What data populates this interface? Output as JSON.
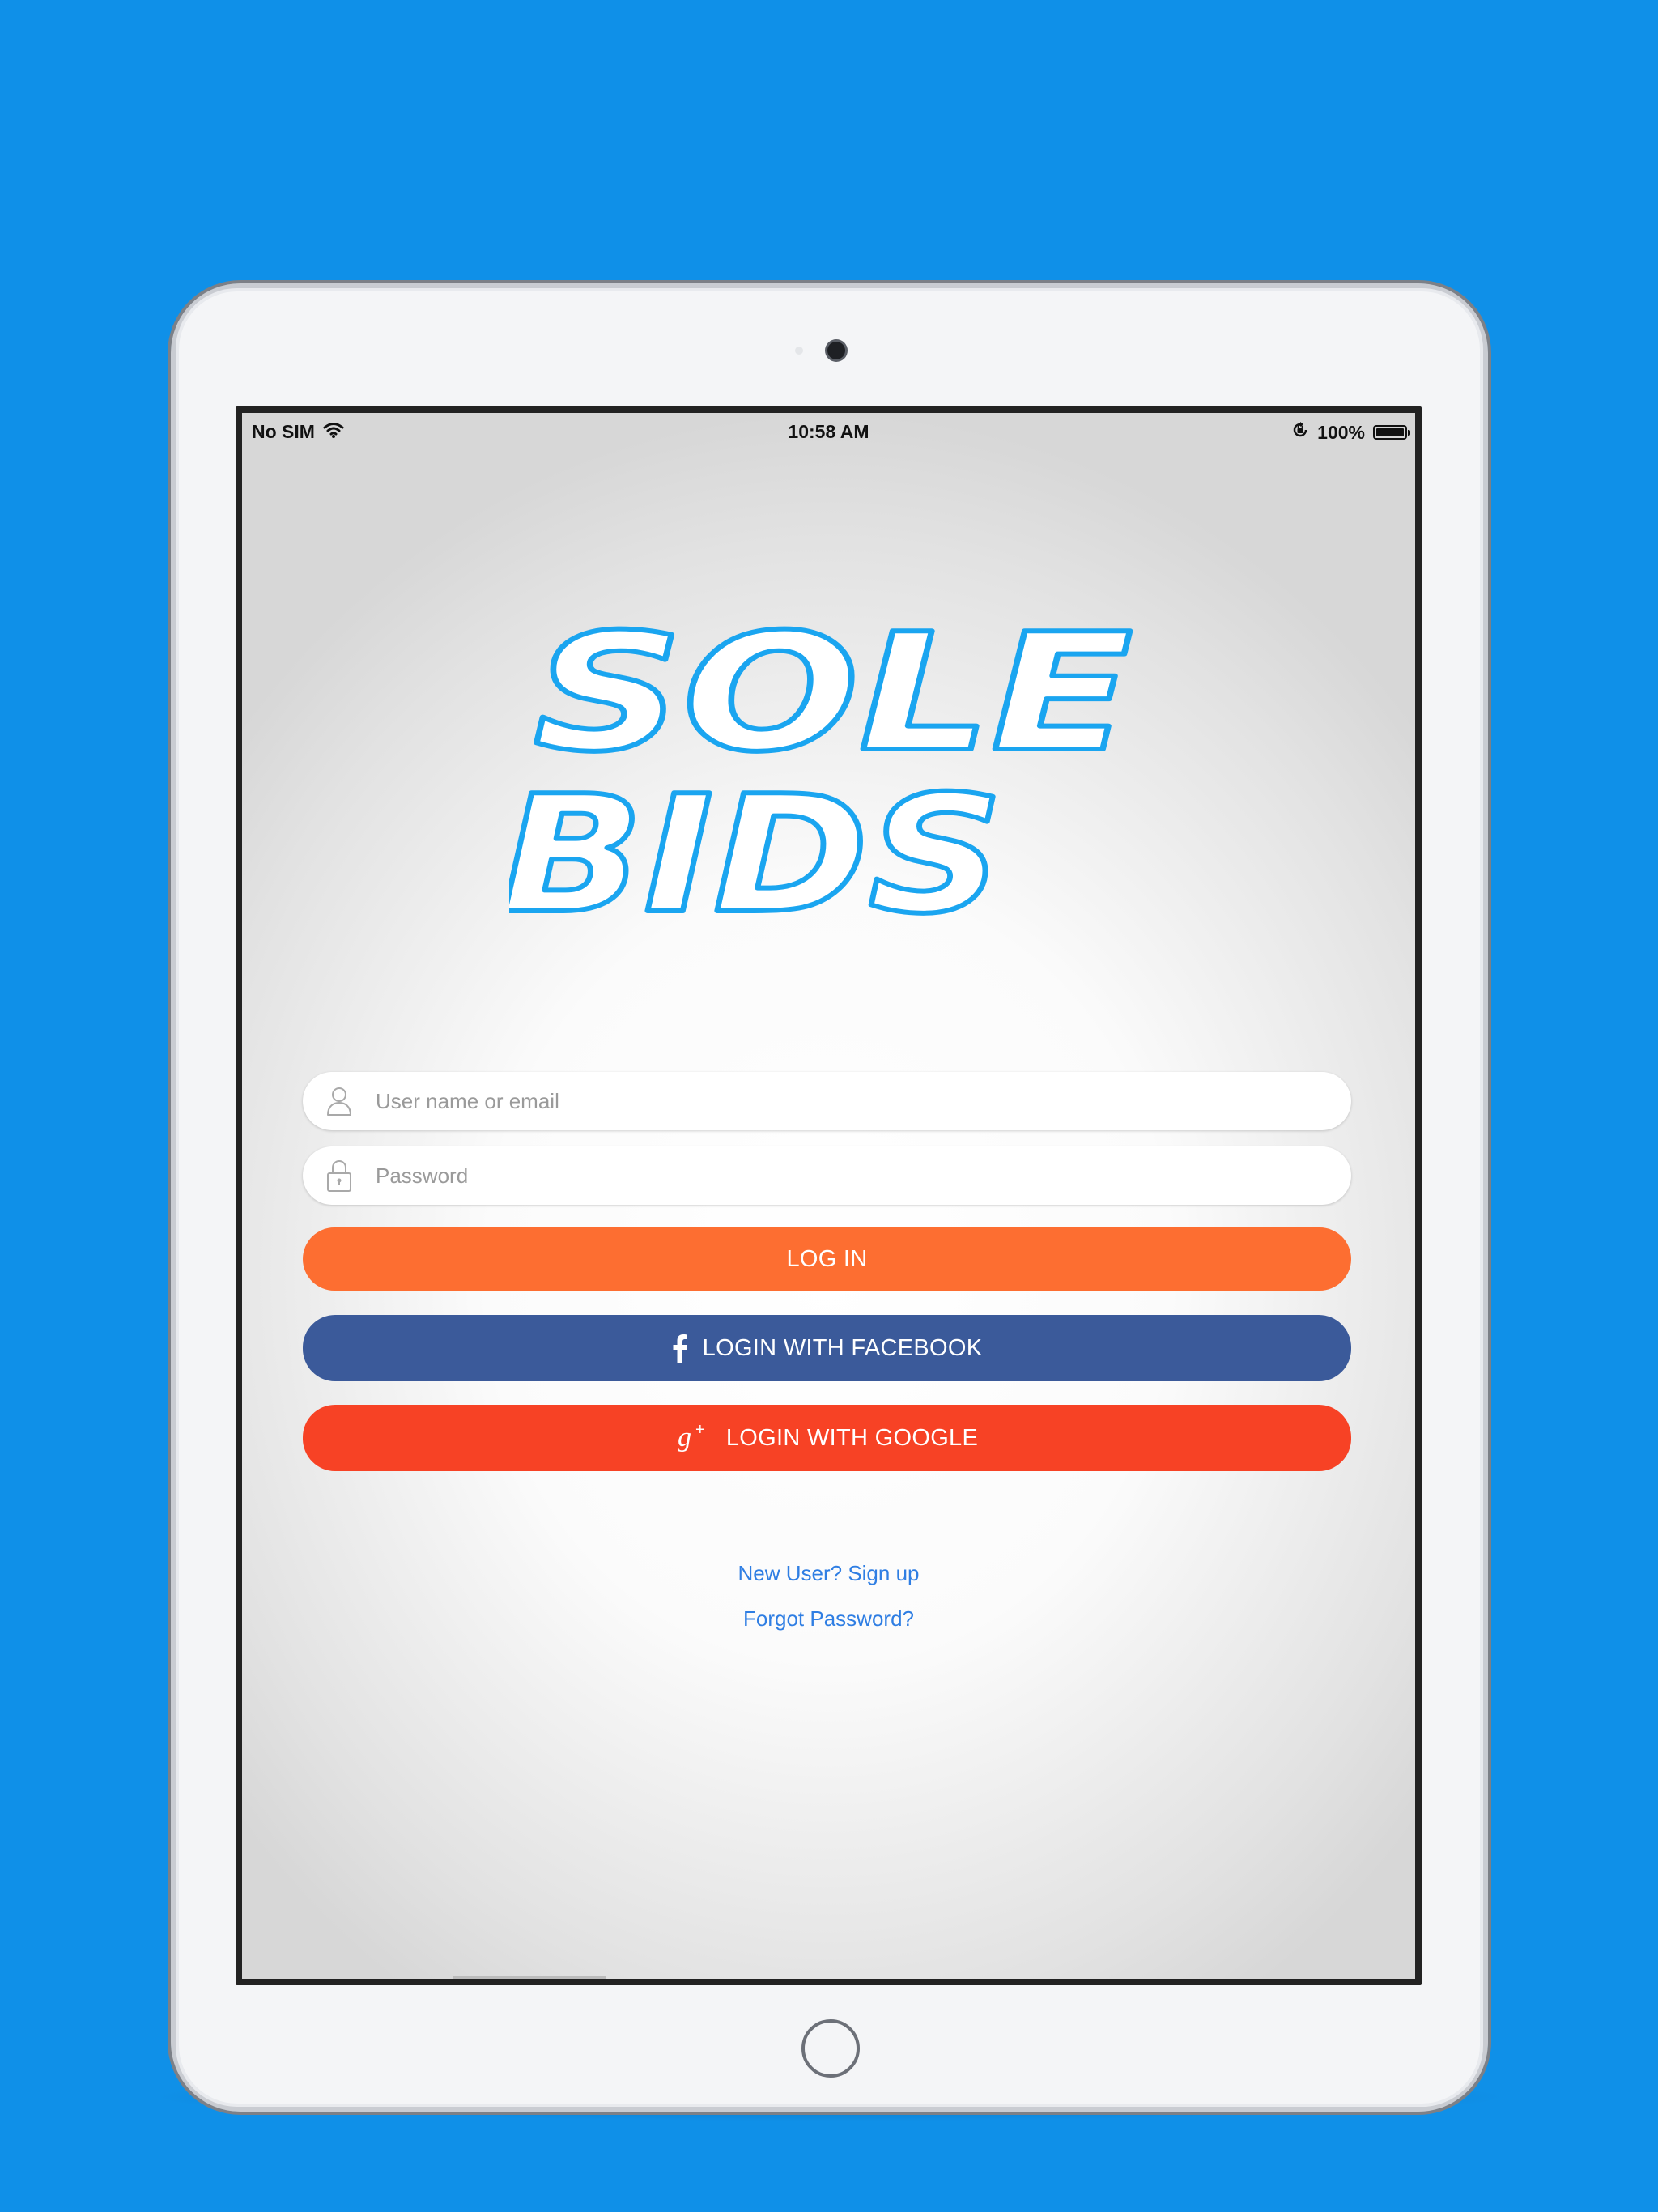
{
  "status_bar": {
    "carrier": "No SIM",
    "time": "10:58 AM",
    "battery_percent": "100%",
    "battery_level": 1.0,
    "icons": [
      "wifi-icon",
      "orientation-lock-icon",
      "battery-icon"
    ]
  },
  "logo": {
    "line1": "SOLE",
    "line2": "BIDS",
    "fill_color": "#ffffff",
    "outline_color": "#1aa5f0"
  },
  "login_form": {
    "username": {
      "placeholder": "User name or email",
      "value": "",
      "icon": "user-icon"
    },
    "password": {
      "placeholder": "Password",
      "value": "",
      "icon": "lock-icon"
    }
  },
  "buttons": {
    "login": {
      "label": "LOG IN",
      "color": "#fd6e31"
    },
    "facebook": {
      "label": "LOGIN WITH FACEBOOK",
      "color": "#3b5a9a",
      "icon": "facebook-icon"
    },
    "google": {
      "label": "LOGIN WITH GOOGLE",
      "color": "#f74225",
      "icon": "google-plus-icon"
    }
  },
  "links": {
    "signup": "New User? Sign up",
    "forgot_password": "Forgot Password?",
    "color": "#2f7ee3"
  },
  "colors": {
    "background": "#0f90e8"
  }
}
